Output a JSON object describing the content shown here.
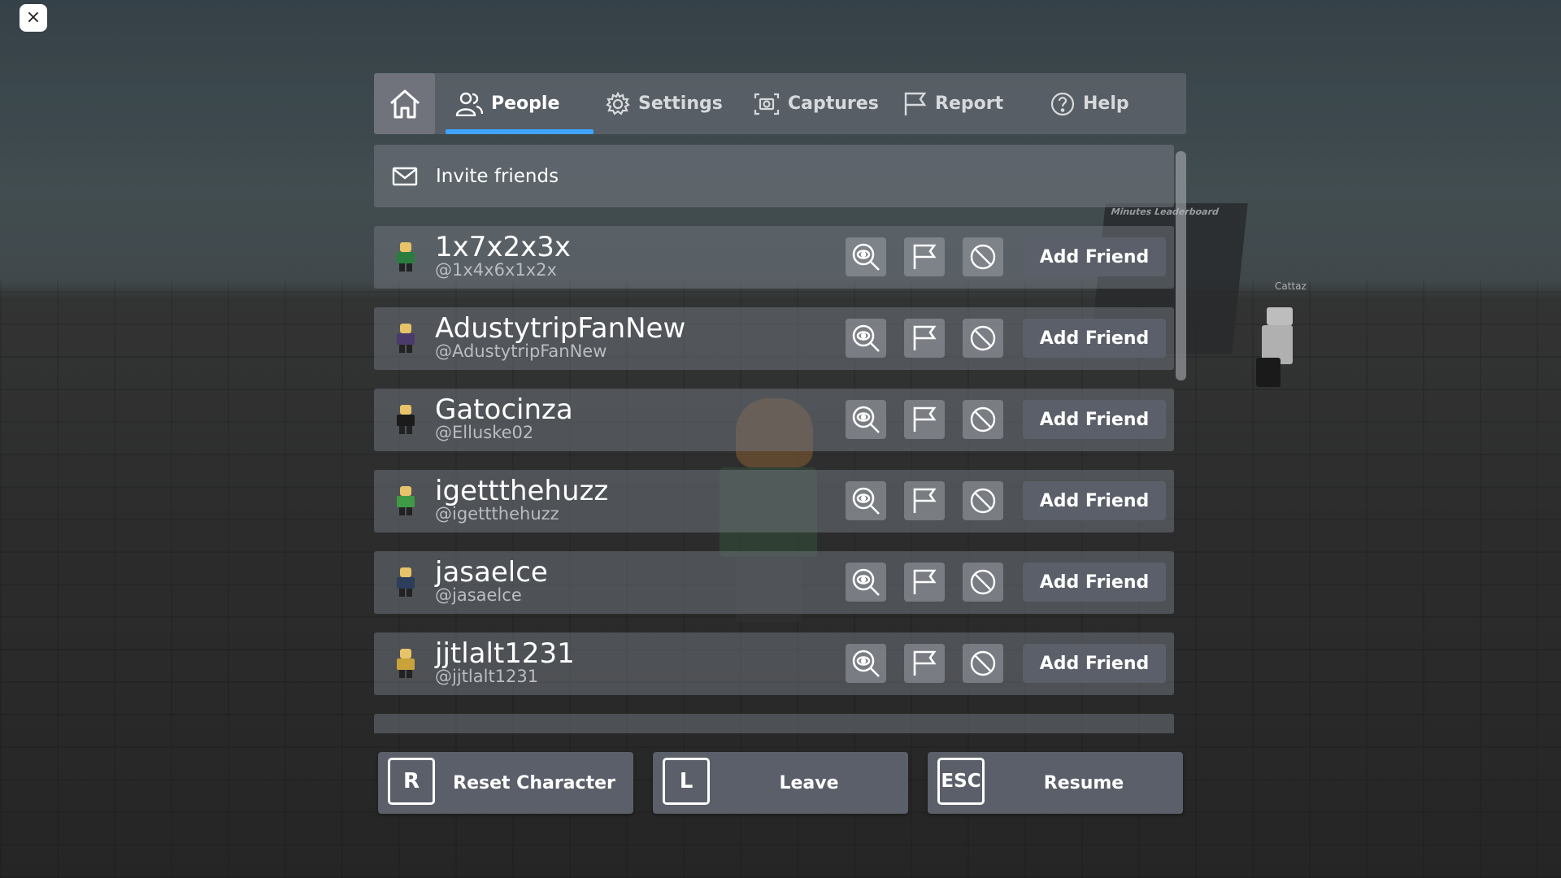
{
  "close": {
    "icon": "close-icon",
    "label": "×"
  },
  "tabs": [
    {
      "label": "People",
      "icon": "people-icon",
      "active": true
    },
    {
      "label": "Settings",
      "icon": "gear-icon",
      "active": false
    },
    {
      "label": "Captures",
      "icon": "camera-icon",
      "active": false
    },
    {
      "label": "Report",
      "icon": "flag-icon",
      "active": false
    },
    {
      "label": "Help",
      "icon": "help-icon",
      "active": false
    }
  ],
  "home": {
    "icon": "home-icon"
  },
  "invite": {
    "label": "Invite friends",
    "icon": "mail-icon"
  },
  "players": [
    {
      "display": "1x7x2x3x",
      "username": "@1x4x6x1x2x",
      "color": "#2a7d3e",
      "action": "Add Friend"
    },
    {
      "display": "AdustytripFanNew",
      "username": "@AdustytripFanNew",
      "color": "#4a3b6a",
      "action": "Add Friend"
    },
    {
      "display": "Gatocinza",
      "username": "@Elluske02",
      "color": "#1b1b1b",
      "action": "Add Friend"
    },
    {
      "display": "igettthehuzz",
      "username": "@igettthehuzz",
      "color": "#3f9a46",
      "action": "Add Friend"
    },
    {
      "display": "jasaelce",
      "username": "@jasaelce",
      "color": "#2c3e5a",
      "action": "Add Friend"
    },
    {
      "display": "jjtlalt1231",
      "username": "@jjtlalt1231",
      "color": "#c9a23a",
      "action": "Add Friend"
    }
  ],
  "row_icons": [
    "inspect-icon",
    "flag-icon",
    "block-icon"
  ],
  "background": {
    "leaderboard_title": "Minutes Leaderboard",
    "npc_name": "Cattaz"
  },
  "actions": [
    {
      "key": "R",
      "label": "Reset Character"
    },
    {
      "key": "L",
      "label": "Leave"
    },
    {
      "key": "ESC",
      "label": "Resume"
    }
  ]
}
